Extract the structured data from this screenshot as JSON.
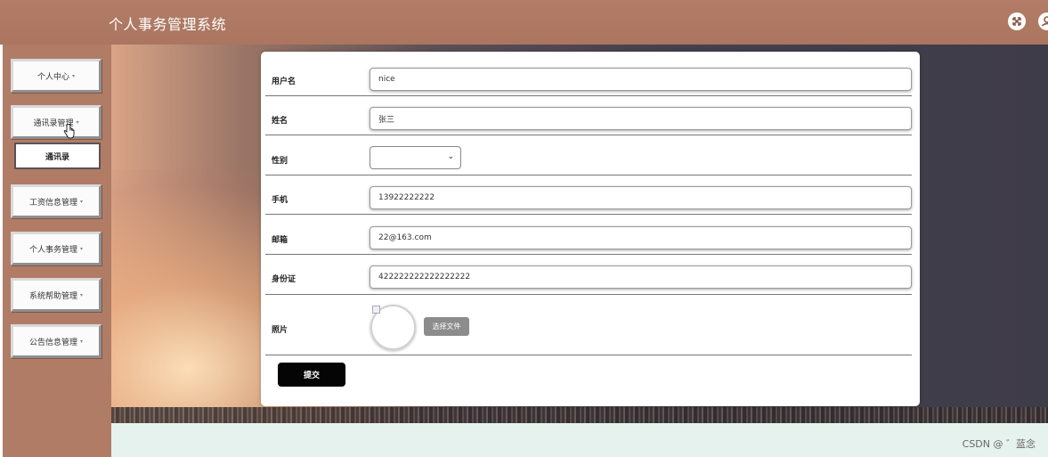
{
  "header": {
    "title": "个人事务管理系统",
    "fullscreen_icon": "fullscreen-icon",
    "user_icon": "user-icon"
  },
  "sidebar": {
    "items": [
      {
        "label": "个人中心"
      },
      {
        "label": "通讯录管理"
      },
      {
        "label": "工资信息管理"
      },
      {
        "label": "个人事务管理"
      },
      {
        "label": "系统帮助管理"
      },
      {
        "label": "公告信息管理"
      }
    ],
    "caret": "▾",
    "submenu": {
      "label": "通讯录"
    }
  },
  "form": {
    "username": {
      "label": "用户名",
      "value": "nice"
    },
    "name": {
      "label": "姓名",
      "value": "张三"
    },
    "gender": {
      "label": "性别",
      "value": ""
    },
    "phone": {
      "label": "手机",
      "value": "13922222222"
    },
    "email": {
      "label": "邮箱",
      "value": "22@163.com"
    },
    "id_card": {
      "label": "身份证",
      "value": "422222222222222222"
    },
    "photo": {
      "label": "照片",
      "file_button": "选择文件"
    },
    "submit": "提交"
  },
  "watermark": "CSDN @ ゛蓝念",
  "colors": {
    "header_bg": "#ab7560",
    "sidebar_bg": "#b17c66",
    "submit_bg": "#050505",
    "bottom_band": "#e6f2ee"
  }
}
